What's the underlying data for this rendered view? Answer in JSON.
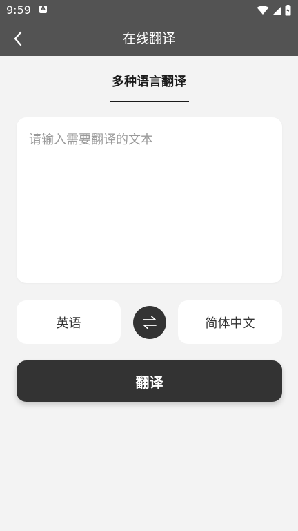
{
  "status_bar": {
    "time": "9:59",
    "notification_icon": "A"
  },
  "app_bar": {
    "title": "在线翻译"
  },
  "tab": {
    "label": "多种语言翻译"
  },
  "input": {
    "placeholder": "请输入需要翻译的文本",
    "value": ""
  },
  "languages": {
    "source": "英语",
    "target": "简体中文"
  },
  "actions": {
    "translate_label": "翻译"
  },
  "colors": {
    "app_bar": "#535353",
    "background": "#f3f3f3",
    "card": "#ffffff",
    "primary_button": "#333333",
    "text": "#1a1a1a"
  }
}
